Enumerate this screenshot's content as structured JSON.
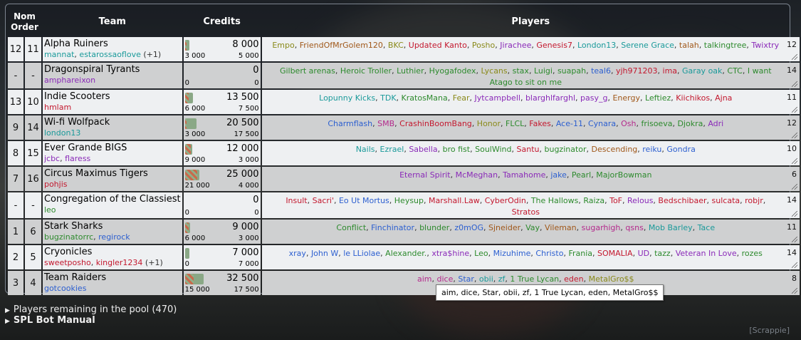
{
  "headers": {
    "nom": "Nom",
    "order": "Order",
    "team": "Team",
    "credits": "Credits",
    "players": "Players"
  },
  "colors": {
    "purple": "#8a2ab8",
    "teal": "#1a9a9a",
    "red": "#c3182e",
    "olive": "#8a8a1a",
    "blue": "#2c5fd0",
    "green": "#2d8a2d",
    "pink": "#b42a8c",
    "brown": "#a0581a",
    "crimson": "#c01030"
  },
  "teams": [
    {
      "nom": "12",
      "order": "11",
      "name": "Alpha Ruiners",
      "captains": [
        {
          "t": "mannat",
          "c": "#1a9a9a"
        },
        {
          "t": ", ",
          "c": "#333"
        },
        {
          "t": "estarossaoflove",
          "c": "#1a9a9a"
        },
        {
          "t": " (+1)",
          "c": "#333"
        }
      ],
      "credits": "8 000",
      "spent": "3 000",
      "left": "5 000",
      "spent_fraction": 0.375,
      "count": "12",
      "players": [
        {
          "t": "Empo",
          "c": "#8a8a1a"
        },
        {
          "t": "FriendOfMrGolem120",
          "c": "#a0581a"
        },
        {
          "t": "BKC",
          "c": "#8a8a1a"
        },
        {
          "t": "Updated Kanto",
          "c": "#c3182e"
        },
        {
          "t": "Posho",
          "c": "#8a8a1a"
        },
        {
          "t": "Jirachee",
          "c": "#8a2ab8"
        },
        {
          "t": "Genesis7",
          "c": "#c3182e"
        },
        {
          "t": "London13",
          "c": "#1a9a9a"
        },
        {
          "t": "Serene Grace",
          "c": "#1a9a9a"
        },
        {
          "t": "talah",
          "c": "#a0581a"
        },
        {
          "t": "talkingtree",
          "c": "#2d8a2d"
        },
        {
          "t": "Twixtry",
          "c": "#8a2ab8"
        }
      ]
    },
    {
      "nom": "-",
      "order": "-",
      "name": "Dragonspiral Tyrants",
      "captains": [
        {
          "t": "amphareixon",
          "c": "#8a2ab8"
        }
      ],
      "credits": "0",
      "spent": "0",
      "left": "0",
      "spent_fraction": 0,
      "count": "14",
      "players": [
        {
          "t": "Gilbert arenas",
          "c": "#2d8a2d"
        },
        {
          "t": "Heroic Troller",
          "c": "#2d8a2d"
        },
        {
          "t": "Luthier",
          "c": "#2d8a2d"
        },
        {
          "t": "Hyogafodex",
          "c": "#2d8a2d"
        },
        {
          "t": "Lycans",
          "c": "#8a8a1a"
        },
        {
          "t": "stax",
          "c": "#2d8a2d"
        },
        {
          "t": "Luigi",
          "c": "#2d8a2d"
        },
        {
          "t": "suapah",
          "c": "#2d8a2d"
        },
        {
          "t": "teal6",
          "c": "#2c5fd0"
        },
        {
          "t": "yjh971203",
          "c": "#c3182e"
        },
        {
          "t": "ima",
          "c": "#c3182e"
        },
        {
          "t": "Garay oak",
          "c": "#1a9a9a"
        },
        {
          "t": "CTC",
          "c": "#2d8a2d"
        },
        {
          "t": "I want Atago to sit on me",
          "c": "#2d8a2d"
        }
      ]
    },
    {
      "nom": "13",
      "order": "10",
      "name": "Indie Scooters",
      "captains": [
        {
          "t": "hmlam",
          "c": "#c3182e"
        }
      ],
      "credits": "13 500",
      "spent": "6 000",
      "left": "7 500",
      "spent_fraction": 0.444,
      "count": "11",
      "players": [
        {
          "t": "Lopunny Kicks",
          "c": "#1a9a9a"
        },
        {
          "t": "TDK",
          "c": "#1a9a9a"
        },
        {
          "t": "KratosMana",
          "c": "#2d8a2d"
        },
        {
          "t": "Fear",
          "c": "#8a8a1a"
        },
        {
          "t": "Jytcampbell",
          "c": "#8a2ab8"
        },
        {
          "t": "blarghlfarghl",
          "c": "#8a2ab8"
        },
        {
          "t": "pasy_g",
          "c": "#8a2ab8"
        },
        {
          "t": "Energy",
          "c": "#a0581a"
        },
        {
          "t": "Leftiez",
          "c": "#2d8a2d"
        },
        {
          "t": "Kiichikos",
          "c": "#c3182e"
        },
        {
          "t": "Ajna",
          "c": "#c3182e"
        }
      ]
    },
    {
      "nom": "9",
      "order": "14",
      "name": "Wi-fi Wolfpack",
      "captains": [
        {
          "t": "london13",
          "c": "#1a9a9a"
        }
      ],
      "credits": "20 500",
      "spent": "3 000",
      "left": "17 500",
      "spent_fraction": 0.146,
      "count": "12",
      "players": [
        {
          "t": "Charmflash",
          "c": "#2c5fd0"
        },
        {
          "t": "SMB",
          "c": "#b42a8c"
        },
        {
          "t": "CrashinBoomBang",
          "c": "#c3182e"
        },
        {
          "t": "Honor",
          "c": "#8a8a1a"
        },
        {
          "t": "FLCL",
          "c": "#2d8a2d"
        },
        {
          "t": "Fakes",
          "c": "#c3182e"
        },
        {
          "t": "Ace-11",
          "c": "#2c5fd0"
        },
        {
          "t": "Cynara",
          "c": "#2c5fd0"
        },
        {
          "t": "Osh",
          "c": "#b42a8c"
        },
        {
          "t": "frisoeva",
          "c": "#2d8a2d"
        },
        {
          "t": "Djokra",
          "c": "#2d8a2d"
        },
        {
          "t": "Adri",
          "c": "#8a2ab8"
        }
      ]
    },
    {
      "nom": "8",
      "order": "15",
      "name": "Ever Grande BIGS",
      "captains": [
        {
          "t": "jcbc",
          "c": "#8a2ab8"
        },
        {
          "t": ", ",
          "c": "#333"
        },
        {
          "t": "flaress",
          "c": "#8a2ab8"
        }
      ],
      "credits": "12 000",
      "spent": "9 000",
      "left": "3 000",
      "spent_fraction": 0.75,
      "count": "10",
      "players": [
        {
          "t": "Nails",
          "c": "#1a9a9a"
        },
        {
          "t": "Ezrael",
          "c": "#1a9a9a"
        },
        {
          "t": "Sabella",
          "c": "#8a2ab8"
        },
        {
          "t": "bro fist",
          "c": "#2d8a2d"
        },
        {
          "t": "SoulWind",
          "c": "#2d8a2d"
        },
        {
          "t": "Santu",
          "c": "#c3182e"
        },
        {
          "t": "bugzinator",
          "c": "#2d8a2d"
        },
        {
          "t": "Descending",
          "c": "#a0581a"
        },
        {
          "t": "reiku",
          "c": "#2c5fd0"
        },
        {
          "t": "Gondra",
          "c": "#2c5fd0"
        }
      ]
    },
    {
      "nom": "7",
      "order": "16",
      "name": "Circus Maximus Tigers",
      "captains": [
        {
          "t": "pohjis",
          "c": "#c3182e"
        }
      ],
      "credits": "25 000",
      "spent": "21 000",
      "left": "4 000",
      "spent_fraction": 0.84,
      "count": "6",
      "players": [
        {
          "t": "Eternal Spirit",
          "c": "#8a2ab8"
        },
        {
          "t": "McMeghan",
          "c": "#8a2ab8"
        },
        {
          "t": "Tamahome",
          "c": "#8a2ab8"
        },
        {
          "t": "jake",
          "c": "#2c5fd0"
        },
        {
          "t": "Pearl",
          "c": "#2d8a2d"
        },
        {
          "t": "MajorBowman",
          "c": "#2d8a2d"
        }
      ]
    },
    {
      "nom": "-",
      "order": "-",
      "name": "Congregation of the Classiest",
      "captains": [
        {
          "t": "leo",
          "c": "#2d8a2d"
        }
      ],
      "credits": "0",
      "spent": "0",
      "left": "0",
      "spent_fraction": 0,
      "count": "14",
      "players": [
        {
          "t": "Insult",
          "c": "#c3182e"
        },
        {
          "t": "Sacri'",
          "c": "#c3182e"
        },
        {
          "t": "Eo Ut Mortus",
          "c": "#2c5fd0"
        },
        {
          "t": "Heysup",
          "c": "#2d8a2d"
        },
        {
          "t": "Marshall.Law",
          "c": "#c3182e"
        },
        {
          "t": "CyberOdin",
          "c": "#c3182e"
        },
        {
          "t": "The Hallows",
          "c": "#2d8a2d"
        },
        {
          "t": "Raiza",
          "c": "#2d8a2d"
        },
        {
          "t": "ToF",
          "c": "#c3182e"
        },
        {
          "t": "Relous",
          "c": "#8a2ab8"
        },
        {
          "t": "Bedschibaer",
          "c": "#c3182e"
        },
        {
          "t": "sulcata",
          "c": "#c3182e"
        },
        {
          "t": "robjr",
          "c": "#c3182e"
        },
        {
          "t": "Stratos",
          "c": "#c3182e"
        }
      ]
    },
    {
      "nom": "1",
      "order": "6",
      "name": "Stark Sharks",
      "captains": [
        {
          "t": "bugzinatorrc",
          "c": "#2d8a2d"
        },
        {
          "t": ", ",
          "c": "#333"
        },
        {
          "t": "regirock",
          "c": "#2c5fd0"
        }
      ],
      "credits": "9 000",
      "spent": "6 000",
      "left": "3 000",
      "spent_fraction": 0.667,
      "count": "11",
      "players": [
        {
          "t": "Conflict",
          "c": "#2d8a2d"
        },
        {
          "t": "Finchinator",
          "c": "#2c5fd0"
        },
        {
          "t": "blunder",
          "c": "#2d8a2d"
        },
        {
          "t": "z0mOG",
          "c": "#2c5fd0"
        },
        {
          "t": "Sjneider",
          "c": "#a0581a"
        },
        {
          "t": "Vay",
          "c": "#2d8a2d"
        },
        {
          "t": "Vileman",
          "c": "#a0581a"
        },
        {
          "t": "sugarhigh",
          "c": "#b42a8c"
        },
        {
          "t": "qsns",
          "c": "#b42a8c"
        },
        {
          "t": "Mob Barley",
          "c": "#1a9a9a"
        },
        {
          "t": "Tace",
          "c": "#1a9a9a"
        }
      ]
    },
    {
      "nom": "2",
      "order": "5",
      "name": "Cryonicles",
      "captains": [
        {
          "t": "sweetposho",
          "c": "#c3182e"
        },
        {
          "t": ", ",
          "c": "#333"
        },
        {
          "t": "kingler1234",
          "c": "#c3182e"
        },
        {
          "t": " (+1)",
          "c": "#333"
        }
      ],
      "credits": "7 000",
      "spent": "0",
      "left": "7 000",
      "spent_fraction": 0,
      "count": "14",
      "players": [
        {
          "t": "xray",
          "c": "#2c5fd0"
        },
        {
          "t": "John W",
          "c": "#2c5fd0"
        },
        {
          "t": "le LLiolae",
          "c": "#2c5fd0"
        },
        {
          "t": "Alexander.",
          "c": "#2d8a2d"
        },
        {
          "t": "xtra$hine",
          "c": "#8a2ab8"
        },
        {
          "t": "Leo",
          "c": "#2d8a2d"
        },
        {
          "t": "Mizuhime",
          "c": "#2c5fd0"
        },
        {
          "t": "Christo",
          "c": "#2c5fd0"
        },
        {
          "t": "Frania",
          "c": "#2d8a2d"
        },
        {
          "t": "SOMALIA",
          "c": "#c3182e"
        },
        {
          "t": "UD",
          "c": "#8a2ab8"
        },
        {
          "t": "tazz",
          "c": "#2d8a2d"
        },
        {
          "t": "Veteran In Love",
          "c": "#8a2ab8"
        },
        {
          "t": "rozes",
          "c": "#2d8a2d"
        }
      ]
    },
    {
      "nom": "3",
      "order": "4",
      "name": "Team Raiders",
      "captains": [
        {
          "t": "gotcookies",
          "c": "#2c5fd0"
        }
      ],
      "credits": "32 500",
      "spent": "15 000",
      "left": "17 500",
      "spent_fraction": 0.4615,
      "count": "8",
      "players": [
        {
          "t": "aim",
          "c": "#b42a8c"
        },
        {
          "t": "dice",
          "c": "#b42a8c"
        },
        {
          "t": "Star",
          "c": "#2c5fd0"
        },
        {
          "t": "obii",
          "c": "#1a9a9a"
        },
        {
          "t": "zf",
          "c": "#1a9a9a"
        },
        {
          "t": "1 True Lycan",
          "c": "#2d8a2d"
        },
        {
          "t": "eden",
          "c": "#c3182e"
        },
        {
          "t": "MetalGro$$",
          "c": "#8a8a1a"
        }
      ]
    }
  ],
  "tooltip": "aim, dice, Star, obii, zf, 1 True Lycan, eden, MetalGro$$",
  "footer": {
    "pool": "Players remaining in the pool (470)",
    "manual": "SPL Bot Manual",
    "credit": "[Scrappie]"
  }
}
